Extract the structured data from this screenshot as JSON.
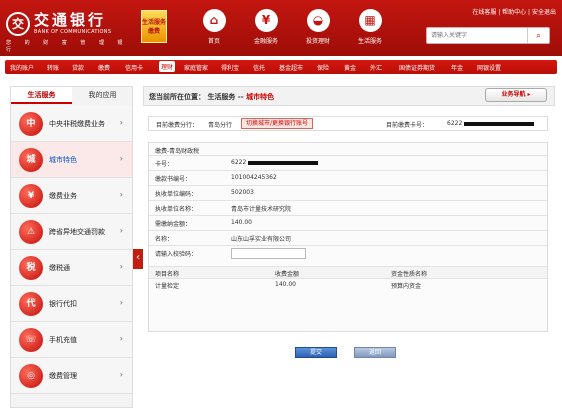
{
  "header": {
    "bank_name_cn": "交通银行",
    "bank_name_en": "BANK OF COMMUNICATIONS",
    "bank_tagline": "您 的 财 富 管 理 银 行",
    "promo_text": "生活服务缴费",
    "nav_items": [
      "首页",
      "金融服务",
      "投资理财",
      "生活服务"
    ],
    "nav_icons": [
      "home-icon",
      "finance-icon",
      "investment-icon",
      "life-service-icon"
    ],
    "top_links": "在线客服 | 帮助中心 | 安全退出",
    "search_placeholder": "请输入关键字",
    "search_icon": "search-icon"
  },
  "subnav": {
    "items": [
      "我的账户",
      "转账",
      "贷款",
      "缴费",
      "信用卡",
      "理财",
      "家庭管家",
      "得利宝",
      "信托",
      "基金超市",
      "保险",
      "黄金",
      "外汇",
      "国债证券期货",
      "年金",
      "网银设置"
    ],
    "active_item": "理财"
  },
  "sidebar": {
    "tabs": [
      "生活服务",
      "我的应用"
    ],
    "items": [
      {
        "label": "中央非税缴费业务",
        "icon": "government-icon"
      },
      {
        "label": "城市特色",
        "icon": "city-icon"
      },
      {
        "label": "缴费业务",
        "icon": "payment-icon"
      },
      {
        "label": "跨省异地交通罚款",
        "icon": "traffic-icon"
      },
      {
        "label": "缴税通",
        "icon": "tax-icon"
      },
      {
        "label": "银行代扣",
        "icon": "bank-debit-icon"
      },
      {
        "label": "手机充值",
        "icon": "phone-icon"
      },
      {
        "label": "缴费管理",
        "icon": "payment-management-icon"
      }
    ],
    "active_index": 1,
    "collapse_glyph": "‹"
  },
  "main": {
    "breadcrumb_prefix": "您当前所在位置：",
    "breadcrumb_parent": "生活服务",
    "breadcrumb_separator": "--",
    "breadcrumb_current": "城市特色",
    "business_guide": "业务导航 ▸",
    "branch_label": "目前缴费分行：",
    "branch_value": "青岛分行",
    "switch_button": "切换城市/更换银行账号",
    "card_label": "目前缴费卡号：",
    "card_value": "6222",
    "form_title": "缴费-青岛财政税",
    "form_rows": [
      {
        "label": "卡号：",
        "value": "6222",
        "masked": true
      },
      {
        "label": "缴款书编号：",
        "value": "101004245362",
        "masked": false
      },
      {
        "label": "执收单位编码：",
        "value": "502003",
        "masked": false
      },
      {
        "label": "执收单位名称：",
        "value": "青岛市计量技术研究院",
        "masked": false
      },
      {
        "label": "需缴纳金额：",
        "value": "140.00",
        "masked": false
      },
      {
        "label": "名称：",
        "value": "山东山孚实业有限公司",
        "masked": false
      },
      {
        "label": "请输入校验码：",
        "value": "",
        "masked": false
      }
    ],
    "fee_headers": [
      "项目名称",
      "收费金额",
      "资金性质名称"
    ],
    "fee_rows": [
      [
        "计量检定",
        "140.00",
        "预算内资金"
      ]
    ],
    "submit_label": "提交",
    "back_label": "返回"
  }
}
